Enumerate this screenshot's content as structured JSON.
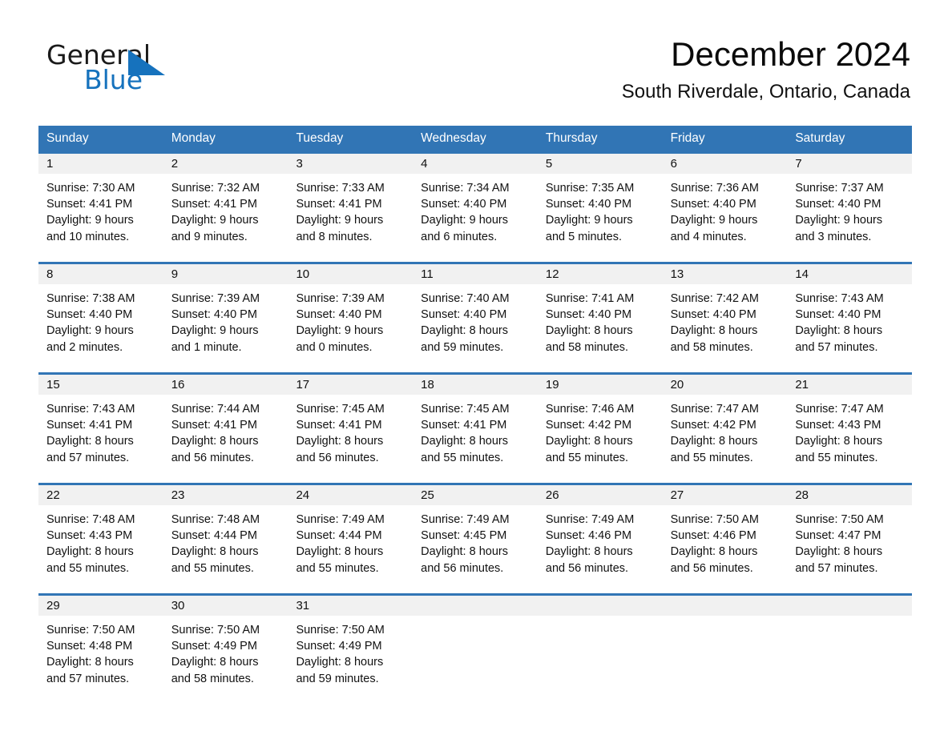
{
  "brand": {
    "name_part1": "General",
    "name_part2": "Blue",
    "accent_color": "#1672bd",
    "triangle_icon": "blue-triangle-icon"
  },
  "header": {
    "title": "December 2024",
    "subtitle": "South Riverdale, Ontario, Canada"
  },
  "calendar": {
    "header_color": "#3175b5",
    "day_band_color": "#f1f1f1",
    "weekday_headers": [
      "Sunday",
      "Monday",
      "Tuesday",
      "Wednesday",
      "Thursday",
      "Friday",
      "Saturday"
    ],
    "weeks": [
      {
        "days": [
          {
            "num": "1",
            "sunrise": "Sunrise: 7:30 AM",
            "sunset": "Sunset: 4:41 PM",
            "daylight_1": "Daylight: 9 hours",
            "daylight_2": "and 10 minutes."
          },
          {
            "num": "2",
            "sunrise": "Sunrise: 7:32 AM",
            "sunset": "Sunset: 4:41 PM",
            "daylight_1": "Daylight: 9 hours",
            "daylight_2": "and 9 minutes."
          },
          {
            "num": "3",
            "sunrise": "Sunrise: 7:33 AM",
            "sunset": "Sunset: 4:41 PM",
            "daylight_1": "Daylight: 9 hours",
            "daylight_2": "and 8 minutes."
          },
          {
            "num": "4",
            "sunrise": "Sunrise: 7:34 AM",
            "sunset": "Sunset: 4:40 PM",
            "daylight_1": "Daylight: 9 hours",
            "daylight_2": "and 6 minutes."
          },
          {
            "num": "5",
            "sunrise": "Sunrise: 7:35 AM",
            "sunset": "Sunset: 4:40 PM",
            "daylight_1": "Daylight: 9 hours",
            "daylight_2": "and 5 minutes."
          },
          {
            "num": "6",
            "sunrise": "Sunrise: 7:36 AM",
            "sunset": "Sunset: 4:40 PM",
            "daylight_1": "Daylight: 9 hours",
            "daylight_2": "and 4 minutes."
          },
          {
            "num": "7",
            "sunrise": "Sunrise: 7:37 AM",
            "sunset": "Sunset: 4:40 PM",
            "daylight_1": "Daylight: 9 hours",
            "daylight_2": "and 3 minutes."
          }
        ]
      },
      {
        "days": [
          {
            "num": "8",
            "sunrise": "Sunrise: 7:38 AM",
            "sunset": "Sunset: 4:40 PM",
            "daylight_1": "Daylight: 9 hours",
            "daylight_2": "and 2 minutes."
          },
          {
            "num": "9",
            "sunrise": "Sunrise: 7:39 AM",
            "sunset": "Sunset: 4:40 PM",
            "daylight_1": "Daylight: 9 hours",
            "daylight_2": "and 1 minute."
          },
          {
            "num": "10",
            "sunrise": "Sunrise: 7:39 AM",
            "sunset": "Sunset: 4:40 PM",
            "daylight_1": "Daylight: 9 hours",
            "daylight_2": "and 0 minutes."
          },
          {
            "num": "11",
            "sunrise": "Sunrise: 7:40 AM",
            "sunset": "Sunset: 4:40 PM",
            "daylight_1": "Daylight: 8 hours",
            "daylight_2": "and 59 minutes."
          },
          {
            "num": "12",
            "sunrise": "Sunrise: 7:41 AM",
            "sunset": "Sunset: 4:40 PM",
            "daylight_1": "Daylight: 8 hours",
            "daylight_2": "and 58 minutes."
          },
          {
            "num": "13",
            "sunrise": "Sunrise: 7:42 AM",
            "sunset": "Sunset: 4:40 PM",
            "daylight_1": "Daylight: 8 hours",
            "daylight_2": "and 58 minutes."
          },
          {
            "num": "14",
            "sunrise": "Sunrise: 7:43 AM",
            "sunset": "Sunset: 4:40 PM",
            "daylight_1": "Daylight: 8 hours",
            "daylight_2": "and 57 minutes."
          }
        ]
      },
      {
        "days": [
          {
            "num": "15",
            "sunrise": "Sunrise: 7:43 AM",
            "sunset": "Sunset: 4:41 PM",
            "daylight_1": "Daylight: 8 hours",
            "daylight_2": "and 57 minutes."
          },
          {
            "num": "16",
            "sunrise": "Sunrise: 7:44 AM",
            "sunset": "Sunset: 4:41 PM",
            "daylight_1": "Daylight: 8 hours",
            "daylight_2": "and 56 minutes."
          },
          {
            "num": "17",
            "sunrise": "Sunrise: 7:45 AM",
            "sunset": "Sunset: 4:41 PM",
            "daylight_1": "Daylight: 8 hours",
            "daylight_2": "and 56 minutes."
          },
          {
            "num": "18",
            "sunrise": "Sunrise: 7:45 AM",
            "sunset": "Sunset: 4:41 PM",
            "daylight_1": "Daylight: 8 hours",
            "daylight_2": "and 55 minutes."
          },
          {
            "num": "19",
            "sunrise": "Sunrise: 7:46 AM",
            "sunset": "Sunset: 4:42 PM",
            "daylight_1": "Daylight: 8 hours",
            "daylight_2": "and 55 minutes."
          },
          {
            "num": "20",
            "sunrise": "Sunrise: 7:47 AM",
            "sunset": "Sunset: 4:42 PM",
            "daylight_1": "Daylight: 8 hours",
            "daylight_2": "and 55 minutes."
          },
          {
            "num": "21",
            "sunrise": "Sunrise: 7:47 AM",
            "sunset": "Sunset: 4:43 PM",
            "daylight_1": "Daylight: 8 hours",
            "daylight_2": "and 55 minutes."
          }
        ]
      },
      {
        "days": [
          {
            "num": "22",
            "sunrise": "Sunrise: 7:48 AM",
            "sunset": "Sunset: 4:43 PM",
            "daylight_1": "Daylight: 8 hours",
            "daylight_2": "and 55 minutes."
          },
          {
            "num": "23",
            "sunrise": "Sunrise: 7:48 AM",
            "sunset": "Sunset: 4:44 PM",
            "daylight_1": "Daylight: 8 hours",
            "daylight_2": "and 55 minutes."
          },
          {
            "num": "24",
            "sunrise": "Sunrise: 7:49 AM",
            "sunset": "Sunset: 4:44 PM",
            "daylight_1": "Daylight: 8 hours",
            "daylight_2": "and 55 minutes."
          },
          {
            "num": "25",
            "sunrise": "Sunrise: 7:49 AM",
            "sunset": "Sunset: 4:45 PM",
            "daylight_1": "Daylight: 8 hours",
            "daylight_2": "and 56 minutes."
          },
          {
            "num": "26",
            "sunrise": "Sunrise: 7:49 AM",
            "sunset": "Sunset: 4:46 PM",
            "daylight_1": "Daylight: 8 hours",
            "daylight_2": "and 56 minutes."
          },
          {
            "num": "27",
            "sunrise": "Sunrise: 7:50 AM",
            "sunset": "Sunset: 4:46 PM",
            "daylight_1": "Daylight: 8 hours",
            "daylight_2": "and 56 minutes."
          },
          {
            "num": "28",
            "sunrise": "Sunrise: 7:50 AM",
            "sunset": "Sunset: 4:47 PM",
            "daylight_1": "Daylight: 8 hours",
            "daylight_2": "and 57 minutes."
          }
        ]
      },
      {
        "days": [
          {
            "num": "29",
            "sunrise": "Sunrise: 7:50 AM",
            "sunset": "Sunset: 4:48 PM",
            "daylight_1": "Daylight: 8 hours",
            "daylight_2": "and 57 minutes."
          },
          {
            "num": "30",
            "sunrise": "Sunrise: 7:50 AM",
            "sunset": "Sunset: 4:49 PM",
            "daylight_1": "Daylight: 8 hours",
            "daylight_2": "and 58 minutes."
          },
          {
            "num": "31",
            "sunrise": "Sunrise: 7:50 AM",
            "sunset": "Sunset: 4:49 PM",
            "daylight_1": "Daylight: 8 hours",
            "daylight_2": "and 59 minutes."
          },
          {
            "num": "",
            "sunrise": "",
            "sunset": "",
            "daylight_1": "",
            "daylight_2": ""
          },
          {
            "num": "",
            "sunrise": "",
            "sunset": "",
            "daylight_1": "",
            "daylight_2": ""
          },
          {
            "num": "",
            "sunrise": "",
            "sunset": "",
            "daylight_1": "",
            "daylight_2": ""
          },
          {
            "num": "",
            "sunrise": "",
            "sunset": "",
            "daylight_1": "",
            "daylight_2": ""
          }
        ]
      }
    ]
  }
}
